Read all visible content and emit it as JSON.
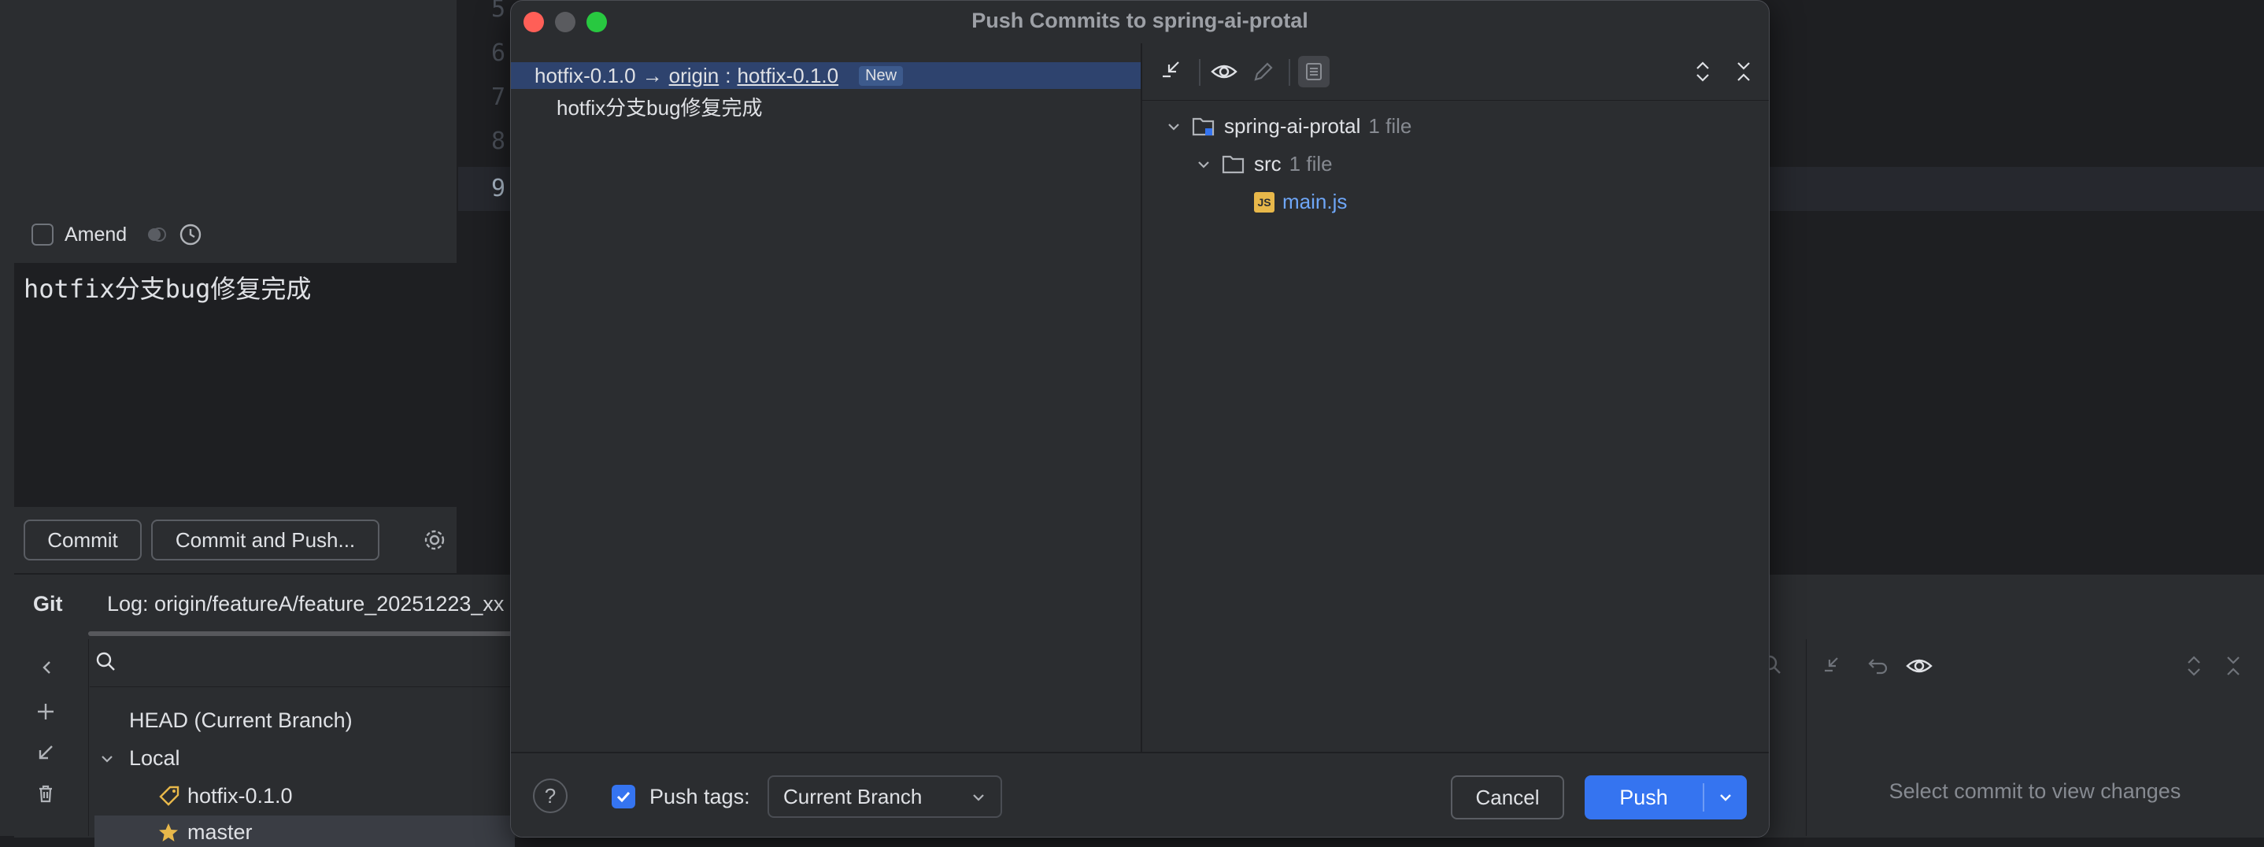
{
  "editor": {
    "line_numbers": [
      "5",
      "6",
      "7",
      "8",
      "9"
    ]
  },
  "commit_panel": {
    "amend_label": "Amend",
    "message": "hotfix分支bug修复完成",
    "commit_button": "Commit",
    "commit_and_push_button": "Commit and Push..."
  },
  "git_window": {
    "title": "Git",
    "log_tab": "Log: origin/featureA/feature_20251223_xx",
    "branches": {
      "head": "HEAD (Current Branch)",
      "local_group": "Local",
      "items": [
        "hotfix-0.1.0",
        "master"
      ]
    },
    "empty_detail": "Select commit to view changes"
  },
  "dialog": {
    "title": "Push Commits to spring-ai-protal",
    "push_spec": {
      "local_branch": "hotfix-0.1.0",
      "arrow": "→",
      "remote": "origin",
      "separator": ":",
      "remote_branch": "hotfix-0.1.0",
      "badge": "New"
    },
    "commits": [
      {
        "message": "hotfix分支bug修复完成"
      }
    ],
    "tree": {
      "root": {
        "name": "spring-ai-protal",
        "count": "1 file"
      },
      "folder": {
        "name": "src",
        "count": "1 file"
      },
      "file": {
        "name": "main.js",
        "type_icon": "JS"
      }
    },
    "footer": {
      "help": "?",
      "push_tags_label": "Push tags:",
      "push_tags_checked": true,
      "push_tags_option": "Current Branch",
      "cancel": "Cancel",
      "push": "Push"
    }
  },
  "colors": {
    "accent": "#3574f0",
    "selection": "#2e436e",
    "file_link": "#6ea6f7"
  }
}
